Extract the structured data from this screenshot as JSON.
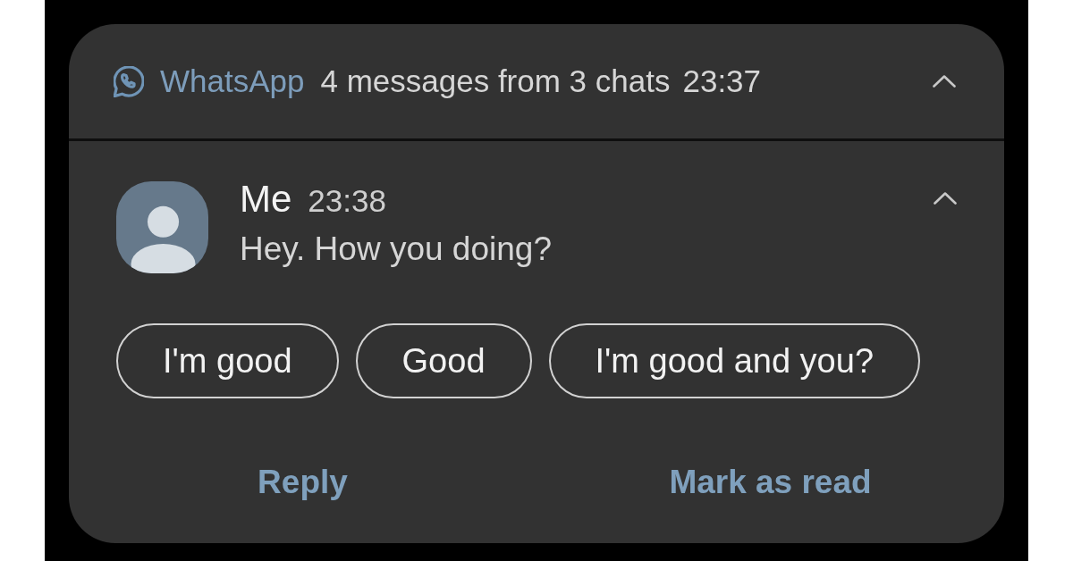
{
  "header": {
    "app_name": "WhatsApp",
    "summary": "4 messages from 3 chats",
    "time": "23:37",
    "expanded": true
  },
  "message": {
    "sender": "Me",
    "time": "23:38",
    "text": "Hey. How you doing?",
    "expanded": true
  },
  "smart_replies": [
    "I'm good",
    "Good",
    "I'm good and you?"
  ],
  "actions": [
    "Reply",
    "Mark as read"
  ]
}
